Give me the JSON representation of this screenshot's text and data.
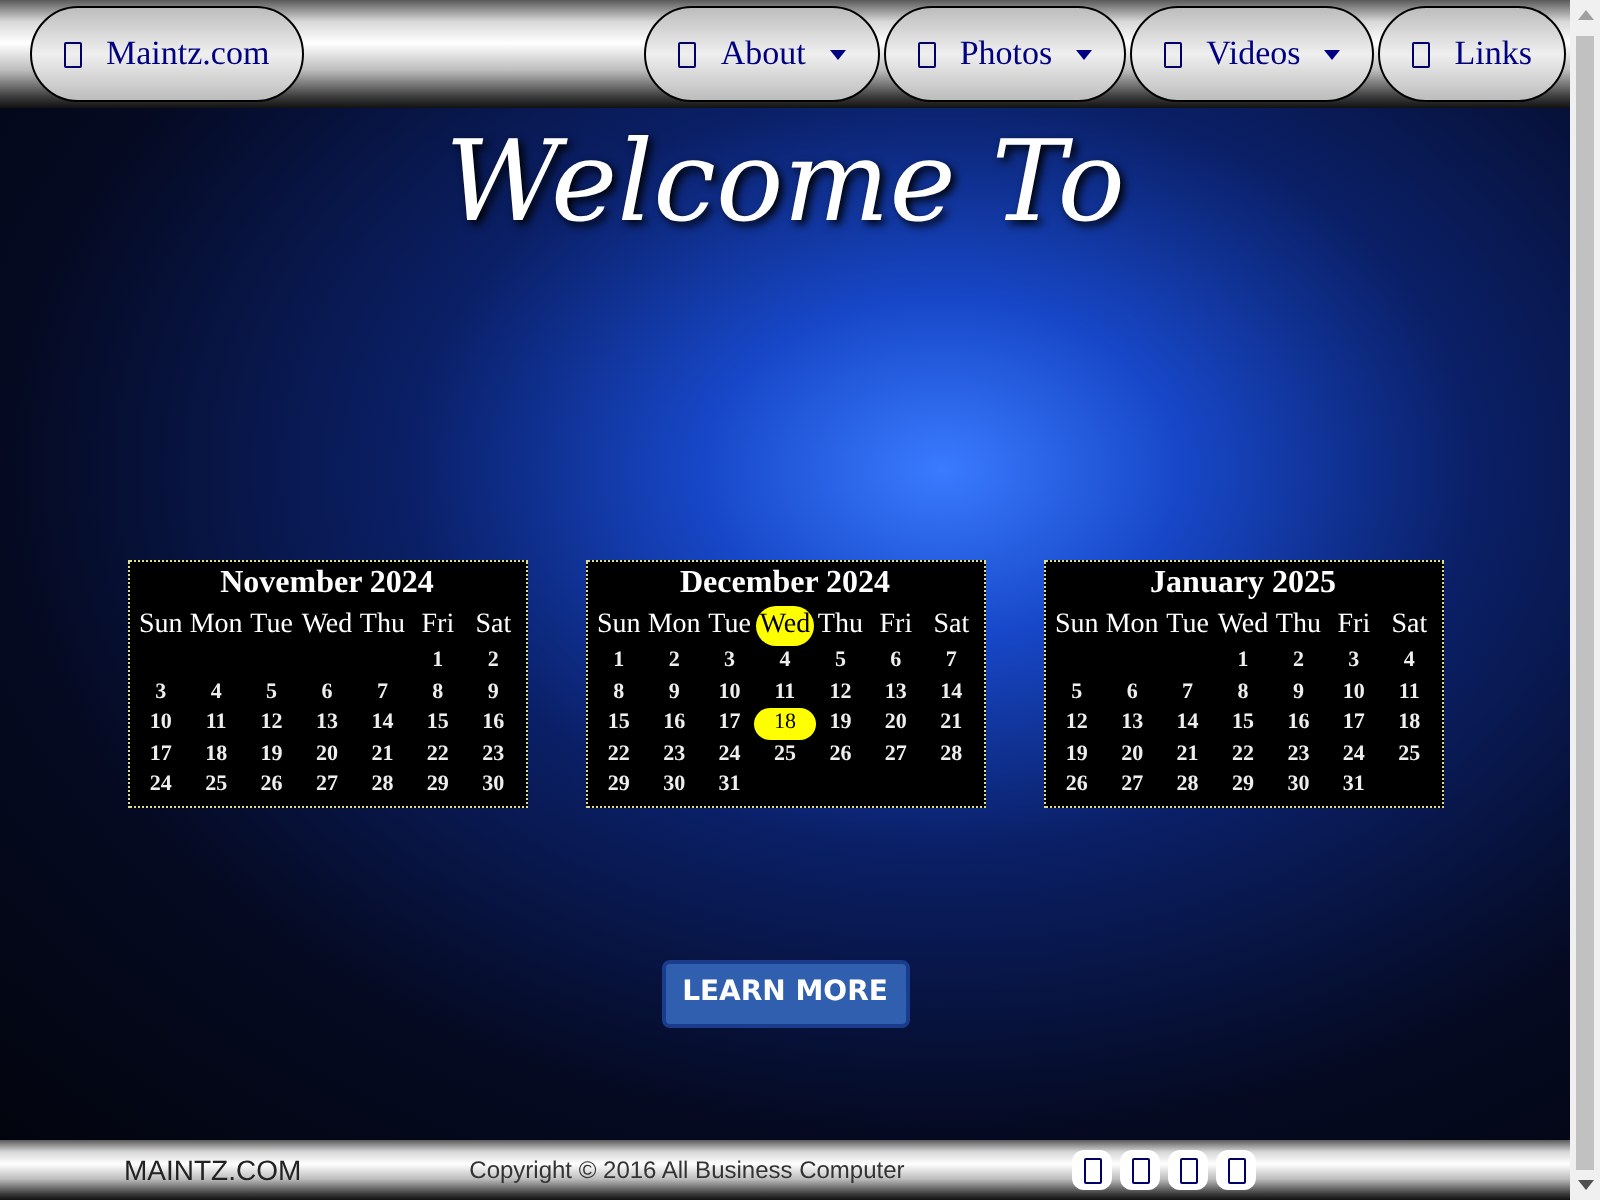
{
  "nav": {
    "brand": "Maintz.com",
    "items": [
      {
        "label": "About",
        "dropdown": true
      },
      {
        "label": "Photos",
        "dropdown": true
      },
      {
        "label": "Videos",
        "dropdown": true
      },
      {
        "label": "Links",
        "dropdown": false
      }
    ]
  },
  "hero": {
    "title": "Welcome To",
    "button": "LEARN MORE"
  },
  "calendars": [
    {
      "title": "November 2024",
      "weekdays": [
        {
          "label": "Sun",
          "selected": false
        },
        {
          "label": "Mon",
          "selected": false
        },
        {
          "label": "Tue",
          "selected": false
        },
        {
          "label": "Wed",
          "selected": false
        },
        {
          "label": "Thu",
          "selected": false
        },
        {
          "label": "Fri",
          "selected": false
        },
        {
          "label": "Sat",
          "selected": false
        }
      ],
      "weeks": [
        [
          {
            "kind": "blank"
          },
          {
            "kind": "blank"
          },
          {
            "kind": "blank"
          },
          {
            "kind": "blank"
          },
          {
            "kind": "blank"
          },
          {
            "kind": "day",
            "d": "1",
            "selected": false
          },
          {
            "kind": "day",
            "d": "2",
            "selected": false
          }
        ],
        [
          {
            "kind": "day",
            "d": "3",
            "selected": false
          },
          {
            "kind": "day",
            "d": "4",
            "selected": false
          },
          {
            "kind": "day",
            "d": "5",
            "selected": false
          },
          {
            "kind": "day",
            "d": "6",
            "selected": false
          },
          {
            "kind": "day",
            "d": "7",
            "selected": false
          },
          {
            "kind": "day",
            "d": "8",
            "selected": false
          },
          {
            "kind": "day",
            "d": "9",
            "selected": false
          }
        ],
        [
          {
            "kind": "day",
            "d": "10",
            "selected": false
          },
          {
            "kind": "day",
            "d": "11",
            "selected": false
          },
          {
            "kind": "day",
            "d": "12",
            "selected": false
          },
          {
            "kind": "day",
            "d": "13",
            "selected": false
          },
          {
            "kind": "day",
            "d": "14",
            "selected": false
          },
          {
            "kind": "day",
            "d": "15",
            "selected": false
          },
          {
            "kind": "day",
            "d": "16",
            "selected": false
          }
        ],
        [
          {
            "kind": "day",
            "d": "17",
            "selected": false
          },
          {
            "kind": "day",
            "d": "18",
            "selected": false
          },
          {
            "kind": "day",
            "d": "19",
            "selected": false
          },
          {
            "kind": "day",
            "d": "20",
            "selected": false
          },
          {
            "kind": "day",
            "d": "21",
            "selected": false
          },
          {
            "kind": "day",
            "d": "22",
            "selected": false
          },
          {
            "kind": "day",
            "d": "23",
            "selected": false
          }
        ],
        [
          {
            "kind": "day",
            "d": "24",
            "selected": false
          },
          {
            "kind": "day",
            "d": "25",
            "selected": false
          },
          {
            "kind": "day",
            "d": "26",
            "selected": false
          },
          {
            "kind": "day",
            "d": "27",
            "selected": false
          },
          {
            "kind": "day",
            "d": "28",
            "selected": false
          },
          {
            "kind": "day",
            "d": "29",
            "selected": false
          },
          {
            "kind": "day",
            "d": "30",
            "selected": false
          }
        ]
      ]
    },
    {
      "title": "December 2024",
      "weekdays": [
        {
          "label": "Sun",
          "selected": false
        },
        {
          "label": "Mon",
          "selected": false
        },
        {
          "label": "Tue",
          "selected": false
        },
        {
          "label": "Wed",
          "selected": true
        },
        {
          "label": "Thu",
          "selected": false
        },
        {
          "label": "Fri",
          "selected": false
        },
        {
          "label": "Sat",
          "selected": false
        }
      ],
      "weeks": [
        [
          {
            "kind": "day",
            "d": "1",
            "selected": false
          },
          {
            "kind": "day",
            "d": "2",
            "selected": false
          },
          {
            "kind": "day",
            "d": "3",
            "selected": false
          },
          {
            "kind": "day",
            "d": "4",
            "selected": false
          },
          {
            "kind": "day",
            "d": "5",
            "selected": false
          },
          {
            "kind": "day",
            "d": "6",
            "selected": false
          },
          {
            "kind": "day",
            "d": "7",
            "selected": false
          }
        ],
        [
          {
            "kind": "day",
            "d": "8",
            "selected": false
          },
          {
            "kind": "day",
            "d": "9",
            "selected": false
          },
          {
            "kind": "day",
            "d": "10",
            "selected": false
          },
          {
            "kind": "day",
            "d": "11",
            "selected": false
          },
          {
            "kind": "day",
            "d": "12",
            "selected": false
          },
          {
            "kind": "day",
            "d": "13",
            "selected": false
          },
          {
            "kind": "day",
            "d": "14",
            "selected": false
          }
        ],
        [
          {
            "kind": "day",
            "d": "15",
            "selected": false
          },
          {
            "kind": "day",
            "d": "16",
            "selected": false
          },
          {
            "kind": "day",
            "d": "17",
            "selected": false
          },
          {
            "kind": "day",
            "d": "18",
            "selected": true
          },
          {
            "kind": "day",
            "d": "19",
            "selected": false
          },
          {
            "kind": "day",
            "d": "20",
            "selected": false
          },
          {
            "kind": "day",
            "d": "21",
            "selected": false
          }
        ],
        [
          {
            "kind": "day",
            "d": "22",
            "selected": false
          },
          {
            "kind": "day",
            "d": "23",
            "selected": false
          },
          {
            "kind": "day",
            "d": "24",
            "selected": false
          },
          {
            "kind": "day",
            "d": "25",
            "selected": false
          },
          {
            "kind": "day",
            "d": "26",
            "selected": false
          },
          {
            "kind": "day",
            "d": "27",
            "selected": false
          },
          {
            "kind": "day",
            "d": "28",
            "selected": false
          }
        ],
        [
          {
            "kind": "day",
            "d": "29",
            "selected": false
          },
          {
            "kind": "day",
            "d": "30",
            "selected": false
          },
          {
            "kind": "day",
            "d": "31",
            "selected": false
          },
          {
            "kind": "blank"
          },
          {
            "kind": "blank"
          },
          {
            "kind": "blank"
          },
          {
            "kind": "blank"
          }
        ]
      ]
    },
    {
      "title": "January 2025",
      "weekdays": [
        {
          "label": "Sun",
          "selected": false
        },
        {
          "label": "Mon",
          "selected": false
        },
        {
          "label": "Tue",
          "selected": false
        },
        {
          "label": "Wed",
          "selected": false
        },
        {
          "label": "Thu",
          "selected": false
        },
        {
          "label": "Fri",
          "selected": false
        },
        {
          "label": "Sat",
          "selected": false
        }
      ],
      "weeks": [
        [
          {
            "kind": "blank"
          },
          {
            "kind": "blank"
          },
          {
            "kind": "blank"
          },
          {
            "kind": "day",
            "d": "1",
            "selected": false
          },
          {
            "kind": "day",
            "d": "2",
            "selected": false
          },
          {
            "kind": "day",
            "d": "3",
            "selected": false
          },
          {
            "kind": "day",
            "d": "4",
            "selected": false
          }
        ],
        [
          {
            "kind": "day",
            "d": "5",
            "selected": false
          },
          {
            "kind": "day",
            "d": "6",
            "selected": false
          },
          {
            "kind": "day",
            "d": "7",
            "selected": false
          },
          {
            "kind": "day",
            "d": "8",
            "selected": false
          },
          {
            "kind": "day",
            "d": "9",
            "selected": false
          },
          {
            "kind": "day",
            "d": "10",
            "selected": false
          },
          {
            "kind": "day",
            "d": "11",
            "selected": false
          }
        ],
        [
          {
            "kind": "day",
            "d": "12",
            "selected": false
          },
          {
            "kind": "day",
            "d": "13",
            "selected": false
          },
          {
            "kind": "day",
            "d": "14",
            "selected": false
          },
          {
            "kind": "day",
            "d": "15",
            "selected": false
          },
          {
            "kind": "day",
            "d": "16",
            "selected": false
          },
          {
            "kind": "day",
            "d": "17",
            "selected": false
          },
          {
            "kind": "day",
            "d": "18",
            "selected": false
          }
        ],
        [
          {
            "kind": "day",
            "d": "19",
            "selected": false
          },
          {
            "kind": "day",
            "d": "20",
            "selected": false
          },
          {
            "kind": "day",
            "d": "21",
            "selected": false
          },
          {
            "kind": "day",
            "d": "22",
            "selected": false
          },
          {
            "kind": "day",
            "d": "23",
            "selected": false
          },
          {
            "kind": "day",
            "d": "24",
            "selected": false
          },
          {
            "kind": "day",
            "d": "25",
            "selected": false
          }
        ],
        [
          {
            "kind": "day",
            "d": "26",
            "selected": false
          },
          {
            "kind": "day",
            "d": "27",
            "selected": false
          },
          {
            "kind": "day",
            "d": "28",
            "selected": false
          },
          {
            "kind": "day",
            "d": "29",
            "selected": false
          },
          {
            "kind": "day",
            "d": "30",
            "selected": false
          },
          {
            "kind": "day",
            "d": "31",
            "selected": false
          },
          {
            "kind": "blank"
          }
        ]
      ]
    }
  ],
  "footer": {
    "brand": "MAINTZ.COM",
    "copyright": "Copyright © 2016 All Business Computer",
    "social_icons": [
      {
        "kind": "social"
      },
      {
        "kind": "social"
      },
      {
        "kind": "social"
      },
      {
        "kind": "social"
      }
    ]
  }
}
